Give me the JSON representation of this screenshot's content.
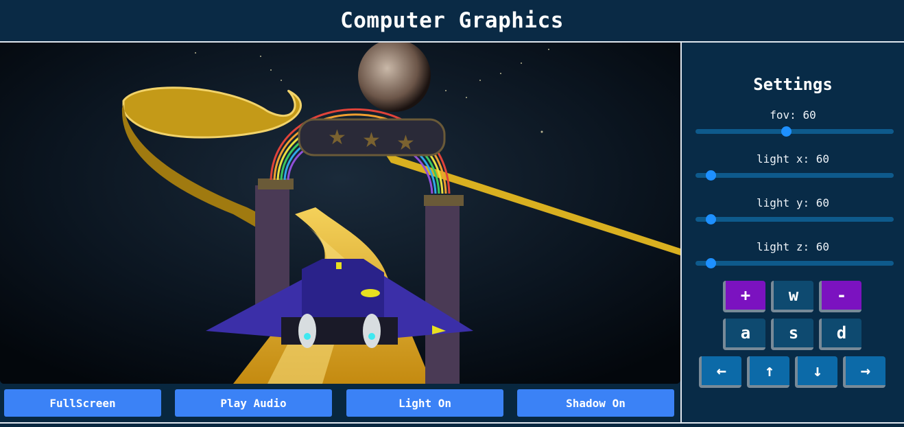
{
  "header": {
    "title": "Computer Graphics"
  },
  "viewport": {
    "scene": "racing-spaceship-3d-scene",
    "colors": {
      "track": "#d9a51a",
      "ship": "#3b2fa8",
      "space": "#050a12",
      "arch": "#4f3b55"
    }
  },
  "buttons": {
    "fullscreen": "FullScreen",
    "play_audio": "Play Audio",
    "light": "Light On",
    "shadow": "Shadow On"
  },
  "settings": {
    "title": "Settings",
    "sliders": [
      {
        "label": "fov: 60",
        "value": 60,
        "max": 140
      },
      {
        "label": "light x: 60",
        "value": 60,
        "max": 1200
      },
      {
        "label": "light y: 60",
        "value": 60,
        "max": 1200
      },
      {
        "label": "light z: 60",
        "value": 60,
        "max": 1200
      }
    ],
    "keys": {
      "plus": "+",
      "w": "w",
      "minus": "-",
      "a": "a",
      "s": "s",
      "d": "d",
      "left": "←",
      "up": "↑",
      "down": "↓",
      "right": "→"
    }
  }
}
